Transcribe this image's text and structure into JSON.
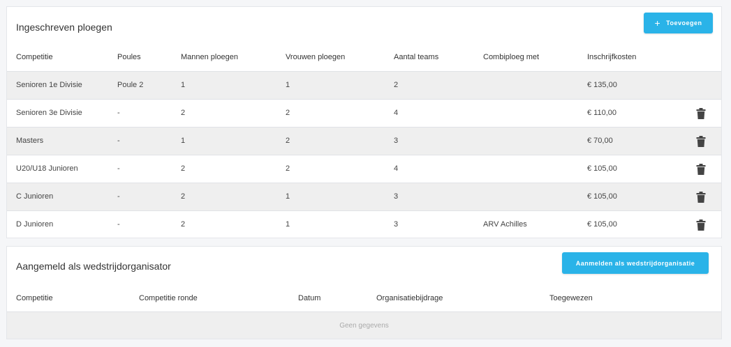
{
  "section1": {
    "title": "Ingeschreven ploegen",
    "add_button": "Toevoegen",
    "headers": [
      "Competitie",
      "Poules",
      "Mannen ploegen",
      "Vrouwen ploegen",
      "Aantal teams",
      "Combiploeg met",
      "Inschrijfkosten"
    ],
    "rows": [
      {
        "competitie": "Senioren 1e Divisie",
        "poules": "Poule 2",
        "mannen": "1",
        "vrouwen": "1",
        "teams": "2",
        "combi": "",
        "kosten": "€ 135,00",
        "deletable": false
      },
      {
        "competitie": "Senioren 3e Divisie",
        "poules": "-",
        "mannen": "2",
        "vrouwen": "2",
        "teams": "4",
        "combi": "",
        "kosten": "€ 110,00",
        "deletable": true
      },
      {
        "competitie": "Masters",
        "poules": "-",
        "mannen": "1",
        "vrouwen": "2",
        "teams": "3",
        "combi": "",
        "kosten": "€ 70,00",
        "deletable": true
      },
      {
        "competitie": "U20/U18 Junioren",
        "poules": "-",
        "mannen": "2",
        "vrouwen": "2",
        "teams": "4",
        "combi": "",
        "kosten": "€ 105,00",
        "deletable": true
      },
      {
        "competitie": "C Junioren",
        "poules": "-",
        "mannen": "2",
        "vrouwen": "1",
        "teams": "3",
        "combi": "",
        "kosten": "€ 105,00",
        "deletable": true
      },
      {
        "competitie": "D Junioren",
        "poules": "-",
        "mannen": "2",
        "vrouwen": "1",
        "teams": "3",
        "combi": "ARV Achilles",
        "kosten": "€ 105,00",
        "deletable": true
      }
    ]
  },
  "section2": {
    "title": "Aangemeld als wedstrijdorganisator",
    "register_button": "Aanmelden als wedstrijdorganisatie",
    "headers": [
      "Competitie",
      "Competitie ronde",
      "Datum",
      "Organisatiebijdrage",
      "Toegewezen"
    ],
    "empty_text": "Geen gegevens"
  },
  "colors": {
    "accent": "#2ab3e8",
    "row_alt": "#efefef",
    "trash": "#444444"
  },
  "icons": {
    "add": "plus-icon",
    "delete": "trash-icon"
  }
}
